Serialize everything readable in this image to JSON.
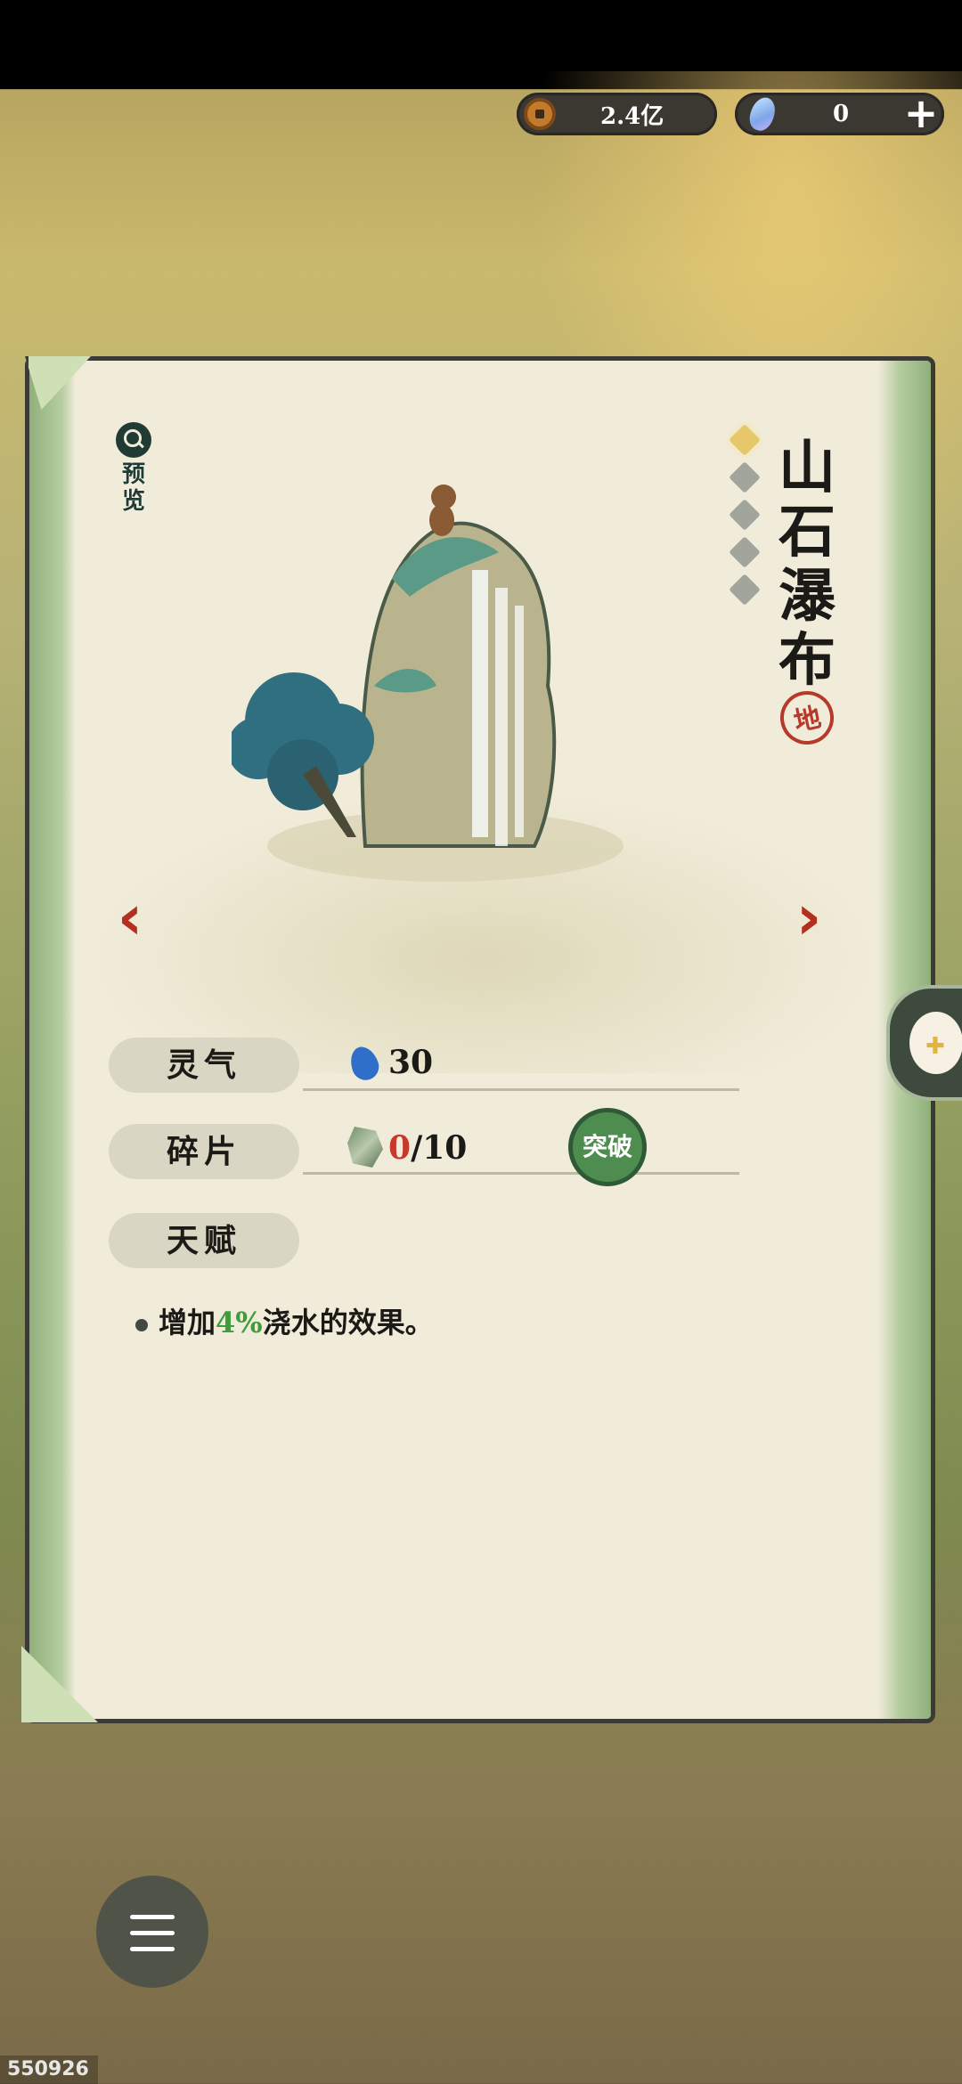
{
  "currency": {
    "coins": "2.4亿",
    "gems": "0",
    "add_symbol": "+"
  },
  "preview": {
    "label": "预览",
    "icon": "magnifier-icon"
  },
  "item": {
    "name": "山石瀑布",
    "grade": "地",
    "stars_filled": 1,
    "stars_total": 5
  },
  "nav": {
    "prev": "‹",
    "next": "›"
  },
  "stats": {
    "spirit_label": "灵气",
    "spirit_value": "30",
    "fragment_label": "碎片",
    "fragment_have": "0",
    "fragment_need": "/10",
    "breakthrough_label": "突破",
    "talent_label": "天赋",
    "talent_desc_prefix": "增加",
    "talent_desc_highlight": "4%",
    "talent_desc_suffix": "浇水的效果。"
  },
  "footer": {
    "build_id": "550926"
  },
  "colors": {
    "accent_red": "#b3301f",
    "highlight_green": "#3f9c3b",
    "button_green": "#4f8c4f"
  }
}
